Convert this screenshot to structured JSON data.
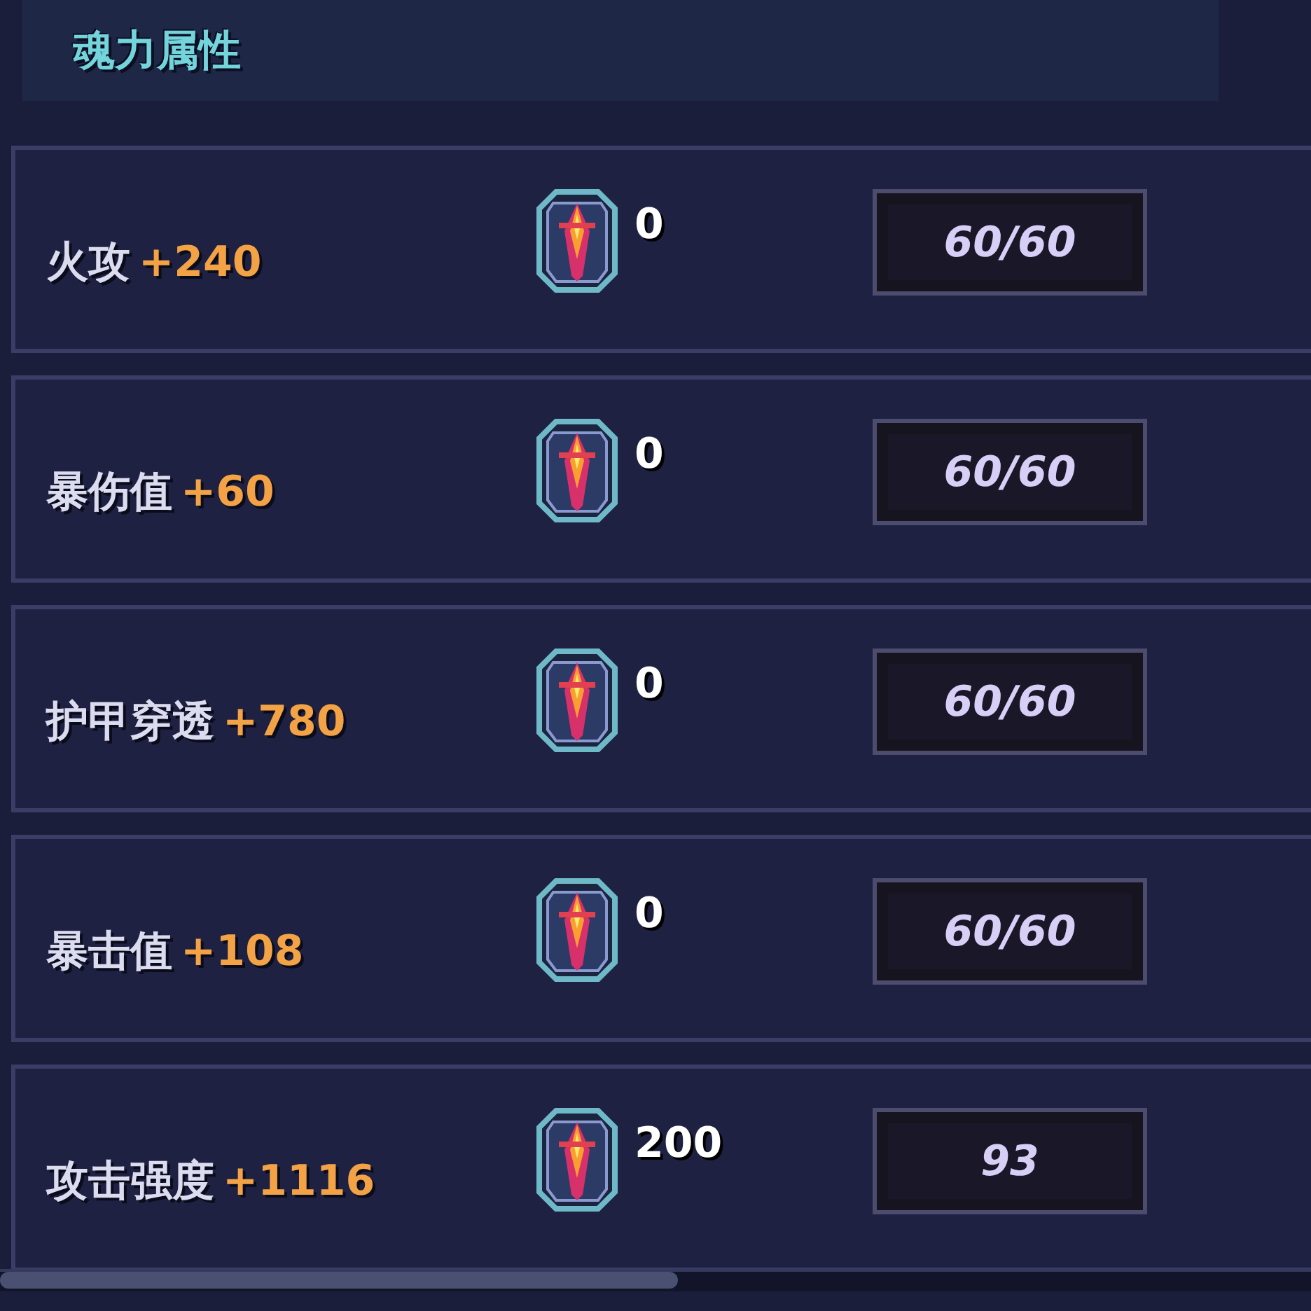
{
  "header": {
    "title": "魂力属性"
  },
  "rows": [
    {
      "name": "火攻",
      "bonus": "+240",
      "count": "0",
      "value": "60/60"
    },
    {
      "name": "暴伤值",
      "bonus": "+60",
      "count": "0",
      "value": "60/60"
    },
    {
      "name": "护甲穿透",
      "bonus": "+780",
      "count": "0",
      "value": "60/60"
    },
    {
      "name": "暴击值",
      "bonus": "+108",
      "count": "0",
      "value": "60/60"
    },
    {
      "name": "攻击强度",
      "bonus": "+1116",
      "count": "200",
      "value": "93"
    }
  ]
}
